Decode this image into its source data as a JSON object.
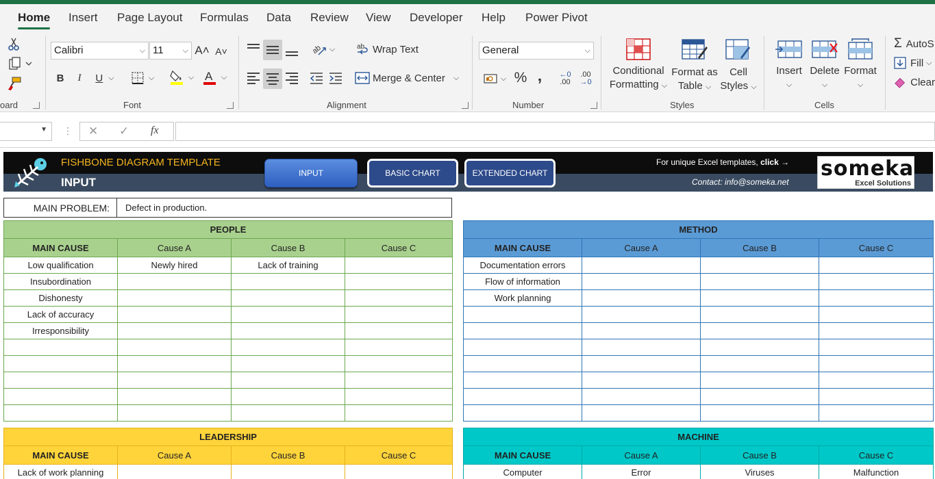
{
  "ribbon_tabs": [
    "Home",
    "Insert",
    "Page Layout",
    "Formulas",
    "Data",
    "Review",
    "View",
    "Developer",
    "Help",
    "Power Pivot"
  ],
  "ribbon": {
    "font_name": "Calibri",
    "font_size": "11",
    "wrap_text": "Wrap Text",
    "merge_center": "Merge & Center",
    "number_format": "General",
    "percent": "%",
    "comma": "‚",
    "inc_decimal": ".00",
    "dec_decimal": ".00",
    "conditional_formatting_1": "Conditional",
    "conditional_formatting_2": "Formatting",
    "format_as_table_1": "Format as",
    "format_as_table_2": "Table",
    "cell_styles_1": "Cell",
    "cell_styles_2": "Styles",
    "insert": "Insert",
    "delete": "Delete",
    "format": "Format",
    "autosum": "AutoS",
    "fill": "Fill",
    "clear": "Clear",
    "groups": {
      "clipboard": "oard",
      "font": "Font",
      "alignment": "Alignment",
      "number": "Number",
      "styles": "Styles",
      "cells": "Cells"
    }
  },
  "formula_bar": {
    "fx": "fx",
    "cancel": "✕",
    "confirm": "✓"
  },
  "banner": {
    "title": "FISHBONE DIAGRAM TEMPLATE",
    "subtitle": "INPUT",
    "nav": [
      "INPUT",
      "BASIC CHART",
      "EXTENDED CHART"
    ],
    "promo_text": "For unique Excel templates,",
    "promo_link": "click →",
    "contact": "Contact: info@someka.net",
    "logo_word": "someka",
    "logo_sub": "Excel Solutions"
  },
  "main_problem": {
    "label": "MAIN PROBLEM:",
    "value": "Defect in production."
  },
  "sections": {
    "people": {
      "title": "PEOPLE",
      "headers": [
        "MAIN CAUSE",
        "Cause A",
        "Cause B",
        "Cause C"
      ],
      "rows": [
        [
          "Low qualification",
          "Newly hired",
          "Lack of training",
          ""
        ],
        [
          "Insubordination",
          "",
          "",
          ""
        ],
        [
          "Dishonesty",
          "",
          "",
          ""
        ],
        [
          "Lack of accuracy",
          "",
          "",
          ""
        ],
        [
          "Irresponsibility",
          "",
          "",
          ""
        ],
        [
          "",
          "",
          "",
          ""
        ],
        [
          "",
          "",
          "",
          ""
        ],
        [
          "",
          "",
          "",
          ""
        ],
        [
          "",
          "",
          "",
          ""
        ],
        [
          "",
          "",
          "",
          ""
        ]
      ]
    },
    "method": {
      "title": "METHOD",
      "headers": [
        "MAIN CAUSE",
        "Cause A",
        "Cause B",
        "Cause C"
      ],
      "rows": [
        [
          "Documentation errors",
          "",
          "",
          ""
        ],
        [
          "Flow of information",
          "",
          "",
          ""
        ],
        [
          "Work planning",
          "",
          "",
          ""
        ],
        [
          "",
          "",
          "",
          ""
        ],
        [
          "",
          "",
          "",
          ""
        ],
        [
          "",
          "",
          "",
          ""
        ],
        [
          "",
          "",
          "",
          ""
        ],
        [
          "",
          "",
          "",
          ""
        ],
        [
          "",
          "",
          "",
          ""
        ],
        [
          "",
          "",
          "",
          ""
        ]
      ]
    },
    "leadership": {
      "title": "LEADERSHIP",
      "headers": [
        "MAIN CAUSE",
        "Cause A",
        "Cause B",
        "Cause C"
      ],
      "rows": [
        [
          "Lack of work planning",
          "",
          "",
          ""
        ]
      ]
    },
    "machine": {
      "title": "MACHINE",
      "headers": [
        "MAIN CAUSE",
        "Cause A",
        "Cause B",
        "Cause C"
      ],
      "rows": [
        [
          "Computer",
          "Error",
          "Viruses",
          "Malfunction"
        ]
      ]
    }
  }
}
